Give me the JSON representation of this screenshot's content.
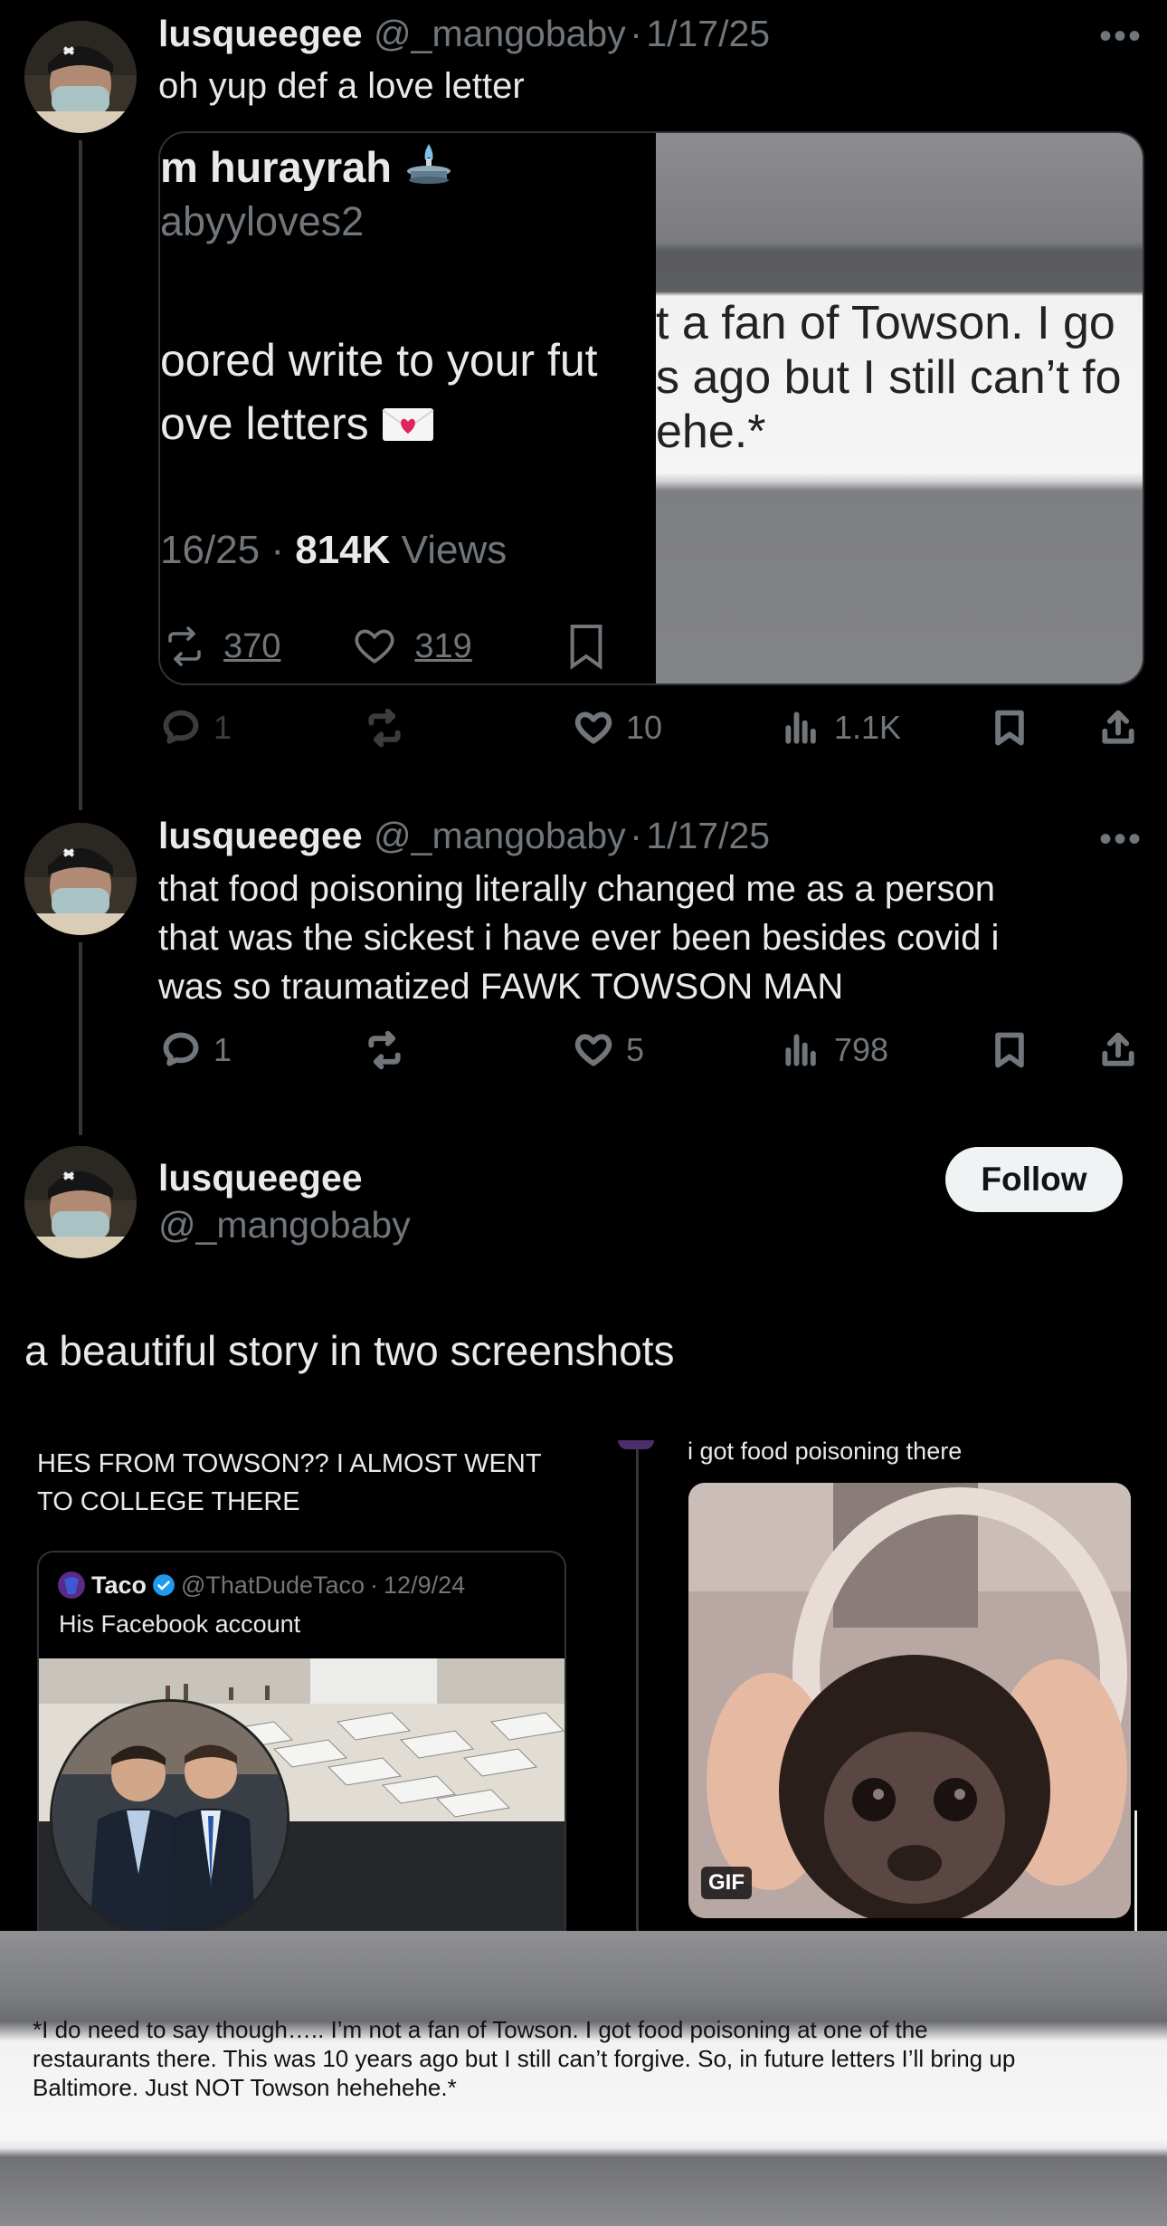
{
  "tweets": [
    {
      "name": "lusqueegee",
      "handle": "@_mangobaby",
      "date": "1/17/25",
      "text": "oh yup def a love letter",
      "quote": {
        "name_fragment": "m hurayrah",
        "handle_fragment": "abyyloves2",
        "text_line1": "oored write to your fut",
        "text_line2": "ove letters",
        "date_fragment": "16/25 ·",
        "views_count": "814K",
        "views_label": "Views",
        "retweets": "370",
        "likes": "319",
        "image_text_line1": "t a fan of Towson. I go",
        "image_text_line2": "s ago but I still can’t fo",
        "image_text_line3": "ehe.*"
      },
      "actions": {
        "replies": "1",
        "retweets": "",
        "likes": "10",
        "views": "1.1K"
      }
    },
    {
      "name": "lusqueegee",
      "handle": "@_mangobaby",
      "date": "1/17/25",
      "text_lines": [
        "that food poisoning literally changed me as a person",
        "that was the sickest i have ever been besides covid i",
        "was so traumatized FAWK TOWSON MAN"
      ],
      "actions": {
        "replies": "1",
        "retweets": "",
        "likes": "5",
        "views": "798"
      }
    }
  ],
  "main_tweet": {
    "name": "lusqueegee",
    "handle": "@_mangobaby",
    "follow_label": "Follow",
    "text": "a beautiful story in two screenshots",
    "left_screenshot": {
      "caption_line1": "HES FROM TOWSON?? I ALMOST WENT",
      "caption_line2": "TO COLLEGE THERE",
      "quoted_name": "Taco",
      "quoted_handle": "@ThatDudeTaco",
      "quoted_date": "12/9/24",
      "quoted_text": "His Facebook account"
    },
    "right_screenshot": {
      "caption": "i got food poisoning there",
      "gif_label": "GIF"
    }
  },
  "bottom_caption": {
    "line1": "*I do need to say though….. I’m not a fan of Towson. I got food poisoning at one of the",
    "line2": "restaurants there. This was 10 years ago but I still can’t forgive. So, in future letters I’ll bring up",
    "line3": "Baltimore. Just NOT Towson hehehehe.*"
  },
  "colors": {
    "background": "#000000",
    "text_primary": "#e7e9ea",
    "text_secondary": "#71767b",
    "verified": "#1d9bf0",
    "follow_bg": "#eff3f4"
  }
}
